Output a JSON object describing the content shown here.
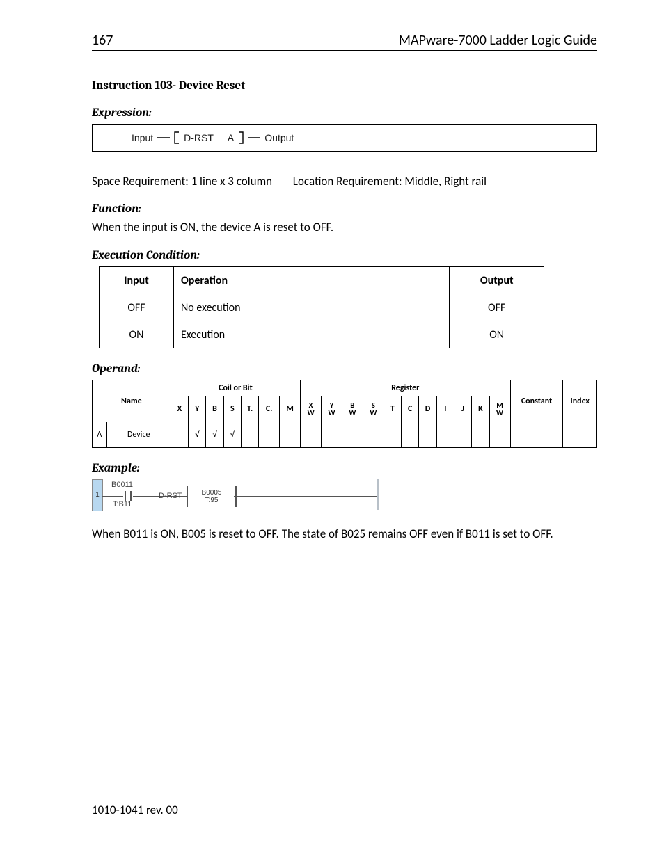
{
  "header": {
    "page_number": "167",
    "doc_title": "MAPware-7000 Ladder Logic Guide"
  },
  "section_title": "Instruction 103- Device Reset",
  "expression": {
    "heading": "Expression:",
    "input_label": "Input",
    "block_label": "D-RST",
    "operand_label": "A",
    "output_label": "Output"
  },
  "requirements": {
    "space": "Space Requirement: 1 line x 3 column",
    "location": "Location Requirement: Middle, Right rail"
  },
  "function": {
    "heading": "Function:",
    "text": "When the input is ON, the device A is reset to OFF."
  },
  "exec": {
    "heading": "Execution Condition:",
    "headers": {
      "input": "Input",
      "operation": "Operation",
      "output": "Output"
    },
    "rows": [
      {
        "input": "OFF",
        "operation": "No execution",
        "output": "OFF"
      },
      {
        "input": "ON",
        "operation": "Execution",
        "output": "ON"
      }
    ]
  },
  "operand": {
    "heading": "Operand:",
    "group_headers": {
      "coil": "Coil or Bit",
      "register": "Register",
      "constant": "Constant",
      "index": "Index"
    },
    "name_header": "Name",
    "cols": [
      "X",
      "Y",
      "B",
      "S",
      "T.",
      "C.",
      "M",
      "XW",
      "YW",
      "BW",
      "SW",
      "T",
      "C",
      "D",
      "I",
      "J",
      "K",
      "MW"
    ],
    "stack_cols": {
      "XW": [
        "X",
        "W"
      ],
      "YW": [
        "Y",
        "W"
      ],
      "BW": [
        "B",
        "W"
      ],
      "SW": [
        "S",
        "W"
      ],
      "MW": [
        "M",
        "W"
      ]
    },
    "rows": [
      {
        "key": "A",
        "name": "Device",
        "marks": {
          "Y": "√",
          "B": "√",
          "S": "√"
        }
      }
    ]
  },
  "example": {
    "heading": "Example:",
    "rung": "1",
    "contact_top": "B0011",
    "contact_bottom": "T:B11",
    "block": "D-RST",
    "coil_top": "B0005",
    "coil_bottom": "T:95",
    "text": "When B011 is ON, B005 is reset to OFF. The state of B025 remains OFF even if B011 is set to OFF."
  },
  "footer": "1010-1041 rev. 00"
}
